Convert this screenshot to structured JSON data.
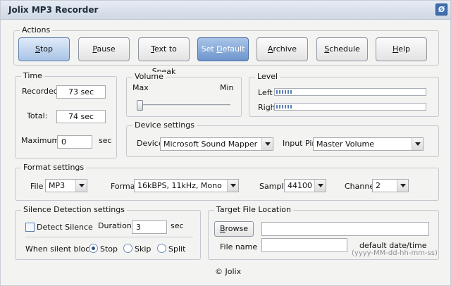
{
  "window": {
    "title": "Jolix MP3 Recorder",
    "sys_icon": "Ø"
  },
  "actions": {
    "legend": "Actions",
    "buttons": [
      "Stop",
      "Pause",
      "Text to Speak",
      "Set Default",
      "Archive",
      "Schedule",
      "Help"
    ],
    "accels": [
      "S",
      "P",
      "T",
      "D",
      "A",
      "S",
      "H"
    ]
  },
  "time": {
    "legend": "Time",
    "recorded_label": "Recorded:",
    "recorded_value": "73 sec",
    "total_label": "Total:",
    "total_value": "74 sec",
    "maximum_label": "Maximum:",
    "maximum_value": "0",
    "maximum_unit": "sec"
  },
  "volume": {
    "legend": "Volume",
    "max_label": "Max",
    "min_label": "Min",
    "level": 0.0
  },
  "level": {
    "legend": "Level",
    "left_label": "Left",
    "right_label": "Right",
    "left_level": 0.11,
    "right_level": 0.11
  },
  "device": {
    "legend": "Device settings",
    "device_label": "Device",
    "device_value": "Microsoft Sound Mapper - Input",
    "input_pin_label": "Input Pin",
    "input_pin_value": "Master Volume"
  },
  "format": {
    "legend": "Format settings",
    "file_label": "File",
    "file_value": "MP3",
    "format_label": "Format",
    "format_value": "16kBPS, 11kHz, Mono",
    "sample_label": "Sample",
    "sample_value": "44100",
    "channel_label": "Channel",
    "channel_value": "2"
  },
  "silence": {
    "legend": "Silence Detection settings",
    "detect_label": "Detect Silence",
    "detect_checked": false,
    "duration_label": "Duration",
    "duration_value": "3",
    "duration_unit": "sec",
    "when_label": "When silent block:",
    "options": [
      "Stop",
      "Skip",
      "Split"
    ],
    "selected": "Stop"
  },
  "target": {
    "legend": "Target File Location",
    "browse_label": "Browse",
    "folder_value": "",
    "filename_label": "File name",
    "filename_value": "",
    "default_label": "default date/time",
    "default_format": "(yyyy-MM-dd-hh-mm-ss)"
  },
  "footer": {
    "copyright": "© Jolix"
  }
}
